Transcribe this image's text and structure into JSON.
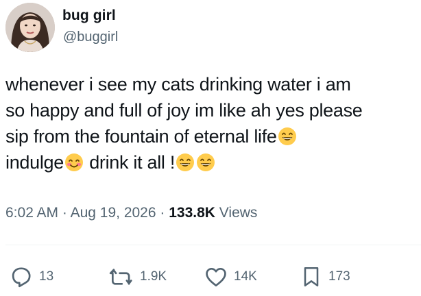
{
  "author": {
    "display_name": "bug girl",
    "handle": "@buggirl",
    "avatar_icon": "profile-photo"
  },
  "tweet": {
    "lines": [
      "whenever i see my cats drinking water i am",
      "so happy and full of joy im like ah yes please",
      "sip from the fountain of eternal life",
      "indulge",
      "drink it all !"
    ],
    "emojis": {
      "grin": "grinning-face-with-smiling-eyes",
      "blush": "smiling-face-with-smiling-eyes"
    }
  },
  "meta": {
    "time": "6:02 AM",
    "separator": "·",
    "date": "Aug 19, 2026",
    "views_count": "133.8K",
    "views_label": "Views"
  },
  "actions": {
    "replies": "13",
    "reposts": "1.9K",
    "likes": "14K",
    "bookmarks": "173"
  },
  "colors": {
    "text": "#0f1419",
    "secondary": "#536471",
    "divider": "#eff3f4"
  }
}
